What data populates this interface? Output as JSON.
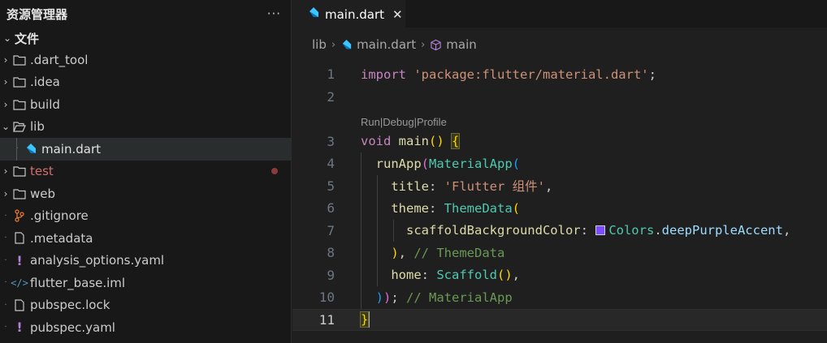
{
  "sidebar": {
    "title": "资源管理器",
    "more": "···",
    "section": "文件",
    "items": [
      {
        "label": ".dart_tool"
      },
      {
        "label": ".idea"
      },
      {
        "label": "build"
      },
      {
        "label": "lib"
      },
      {
        "label": "main.dart"
      },
      {
        "label": "test"
      },
      {
        "label": "web"
      },
      {
        "label": ".gitignore"
      },
      {
        "label": ".metadata"
      },
      {
        "label": "analysis_options.yaml"
      },
      {
        "label": "flutter_base.iml"
      },
      {
        "label": "pubspec.lock"
      },
      {
        "label": "pubspec.yaml"
      }
    ]
  },
  "editor": {
    "tab": {
      "label": "main.dart",
      "close": "✕"
    },
    "breadcrumb": [
      "lib",
      "main.dart",
      "main"
    ],
    "codelens": {
      "run": "Run",
      "sep1": " | ",
      "debug": "Debug",
      "sep2": " | ",
      "profile": "Profile"
    },
    "line_numbers": [
      "1",
      "2",
      "3",
      "4",
      "5",
      "6",
      "7",
      "8",
      "9",
      "10",
      "11"
    ],
    "code": {
      "l1_import": "import",
      "l1_str": "'package:flutter/material.dart'",
      "l1_end": ";",
      "l3_void": "void",
      "l3_main": "main",
      "l3_parens": "()",
      "l3_brace": "{",
      "l4_fn": "runApp",
      "l4_paren": "(",
      "l4_cls": "MaterialApp",
      "l4_paren2": "(",
      "l5_prop": "title",
      "l5_colon": ": ",
      "l5_str": "'Flutter 组件'",
      "l5_comma": ",",
      "l6_prop": "theme",
      "l6_colon": ": ",
      "l6_cls": "ThemeData",
      "l6_paren": "(",
      "l7_prop": "scaffoldBackgroundColor",
      "l7_colon": ": ",
      "l7_cls": "Colors",
      "l7_dot": ".",
      "l7_member": "deepPurpleAccent",
      "l7_comma": ",",
      "l8_paren": ")",
      "l8_comma": ", ",
      "l8_comment": "// ThemeData",
      "l9_prop": "home",
      "l9_colon": ": ",
      "l9_cls": "Scaffold",
      "l9_parens": "()",
      "l9_comma": ",",
      "l10_paren1": ")",
      "l10_paren2": ")",
      "l10_semi": "; ",
      "l10_comment": "// MaterialApp",
      "l11_brace": "}"
    },
    "swatch_color": "#7c4dff"
  }
}
